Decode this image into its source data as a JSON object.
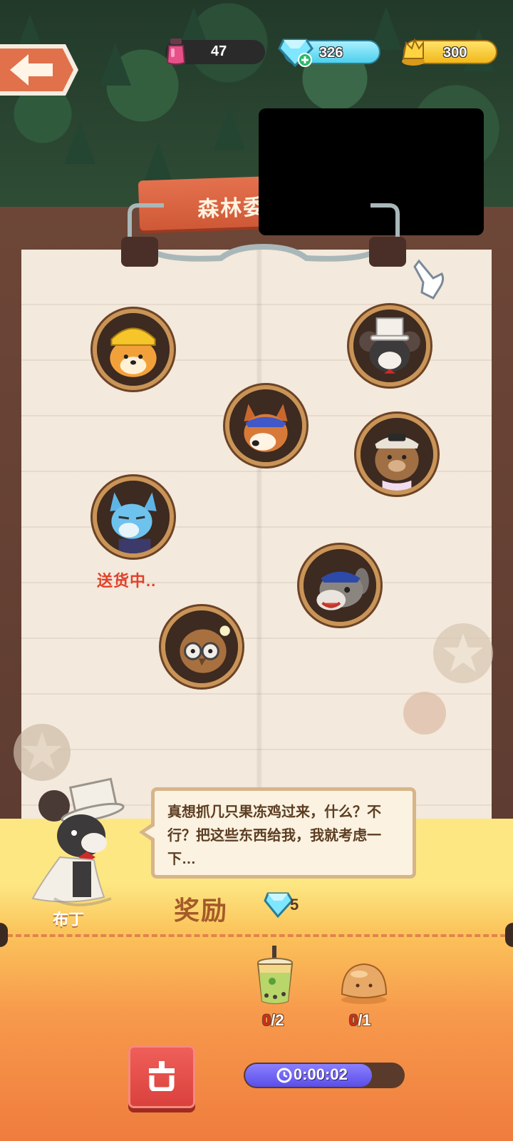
{
  "resources": {
    "ink": "47",
    "gems": "326",
    "gold": "300"
  },
  "title": "森林委",
  "characters": [
    {
      "name": "shiba",
      "status": ""
    },
    {
      "name": "mouse-tophat",
      "status": ""
    },
    {
      "name": "corgi",
      "status": ""
    },
    {
      "name": "bear",
      "status": ""
    },
    {
      "name": "wolf",
      "status": "送货中.."
    },
    {
      "name": "donkey",
      "status": ""
    },
    {
      "name": "owl",
      "status": ""
    }
  ],
  "npc": {
    "name": "布丁",
    "dialogue": "真想抓几只果冻鸡过来，什么？不行？把这些东西给我，我就考虑一下…"
  },
  "reward": {
    "label": "奖励",
    "gem_count": "5"
  },
  "requirements": [
    {
      "item": "bubble-tea",
      "have": "0",
      "need": "/2"
    },
    {
      "item": "bread",
      "have": "0",
      "need": "/1"
    }
  ],
  "timer": {
    "value": "0:00:02",
    "progress": 0.8
  }
}
